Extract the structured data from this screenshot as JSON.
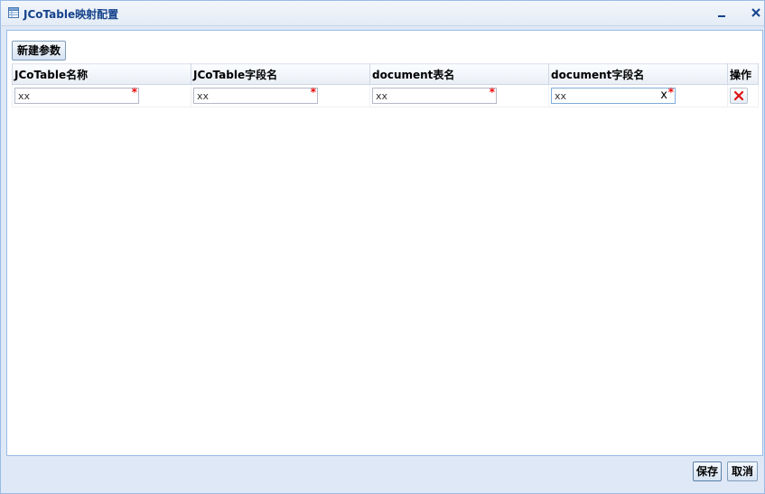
{
  "window": {
    "title": "JCoTable映射配置",
    "minimize_icon": "minimize-icon",
    "close_icon": "close-icon"
  },
  "toolbar": {
    "new_param_label": "新建参数"
  },
  "grid": {
    "columns": [
      "JCoTable名称",
      "JCoTable字段名",
      "document表名",
      "document字段名",
      "操作"
    ],
    "rows": [
      {
        "jco_table_name": "xx",
        "jco_field_name": "xx",
        "document_table_name": "xx",
        "document_field_name": "xx",
        "delete_icon": "delete-x-icon"
      }
    ],
    "required_mark": "*",
    "clear_mark": "x"
  },
  "footer": {
    "save_label": "保存",
    "cancel_label": "取消"
  },
  "colors": {
    "title_text": "#15428b",
    "border": "#99bbe8",
    "required": "#ee0000",
    "delete": "#dd1111"
  }
}
